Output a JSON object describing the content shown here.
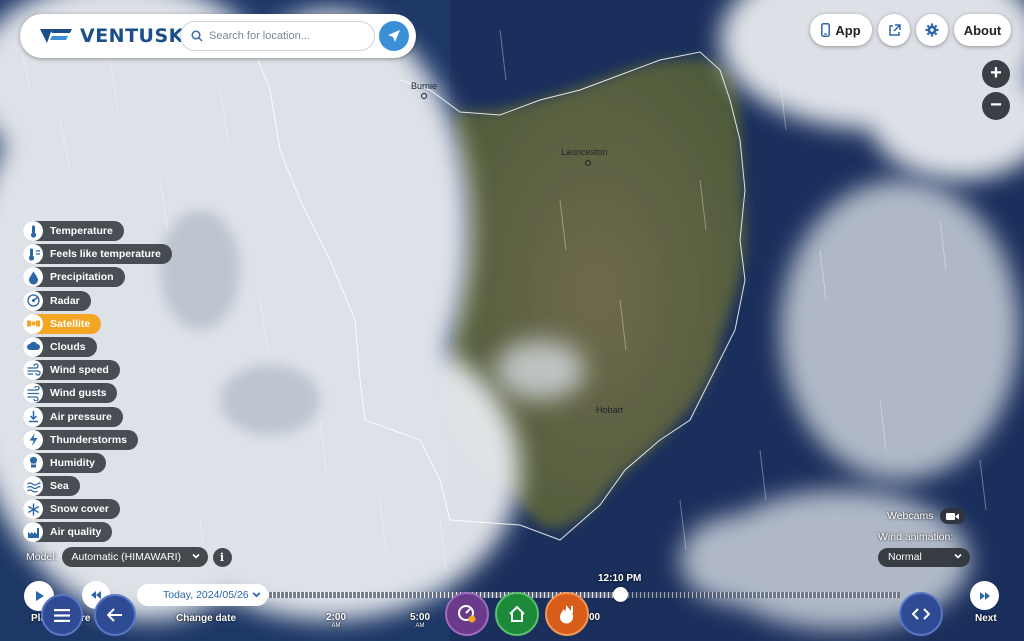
{
  "brand": {
    "name": "VENTUSKY"
  },
  "search": {
    "placeholder": "Search for location..."
  },
  "header": {
    "app_label": "App",
    "about_label": "About"
  },
  "zoom": {
    "in_label": "+",
    "out_label": "−"
  },
  "layers": [
    {
      "label": "Temperature",
      "icon": "thermometer-icon",
      "active": false
    },
    {
      "label": "Feels like temperature",
      "icon": "feels-like-icon",
      "active": false
    },
    {
      "label": "Precipitation",
      "icon": "raindrop-icon",
      "active": false
    },
    {
      "label": "Radar",
      "icon": "radar-icon",
      "active": false
    },
    {
      "label": "Satellite",
      "icon": "satellite-icon",
      "active": true
    },
    {
      "label": "Clouds",
      "icon": "cloud-icon",
      "active": false
    },
    {
      "label": "Wind speed",
      "icon": "wind-icon",
      "active": false
    },
    {
      "label": "Wind gusts",
      "icon": "wind-gust-icon",
      "active": false
    },
    {
      "label": "Air pressure",
      "icon": "pressure-icon",
      "active": false
    },
    {
      "label": "Thunderstorms",
      "icon": "lightning-icon",
      "active": false
    },
    {
      "label": "Humidity",
      "icon": "humidity-icon",
      "active": false
    },
    {
      "label": "Sea",
      "icon": "waves-icon",
      "active": false
    },
    {
      "label": "Snow cover",
      "icon": "snowflake-icon",
      "active": false
    },
    {
      "label": "Air quality",
      "icon": "factory-icon",
      "active": false
    }
  ],
  "model": {
    "label": "Model:",
    "value": "Automatic (HIMAWARI)",
    "info": "i"
  },
  "cities": {
    "burnie": "Burnie",
    "launceston": "Launceston",
    "hobart": "Hobart"
  },
  "webcams": {
    "label": "Webcams"
  },
  "wind_animation": {
    "label": "Wind animation:",
    "value": "Normal"
  },
  "timeline": {
    "date": "Today, 2024/05/26",
    "change_date_label": "Change date",
    "current_time": "12:10 PM",
    "ticks": [
      {
        "time": "2:00",
        "ampm": "AM"
      },
      {
        "time": "5:00",
        "ampm": "AM"
      },
      {
        "time": "00",
        "ampm": ""
      }
    ],
    "play_label": "Pla",
    "prev_label": "re",
    "next_label": "Next"
  },
  "colors": {
    "accent": "#f2a623",
    "brand": "#1a4f8a",
    "button_blue": "#3b8fd6"
  }
}
